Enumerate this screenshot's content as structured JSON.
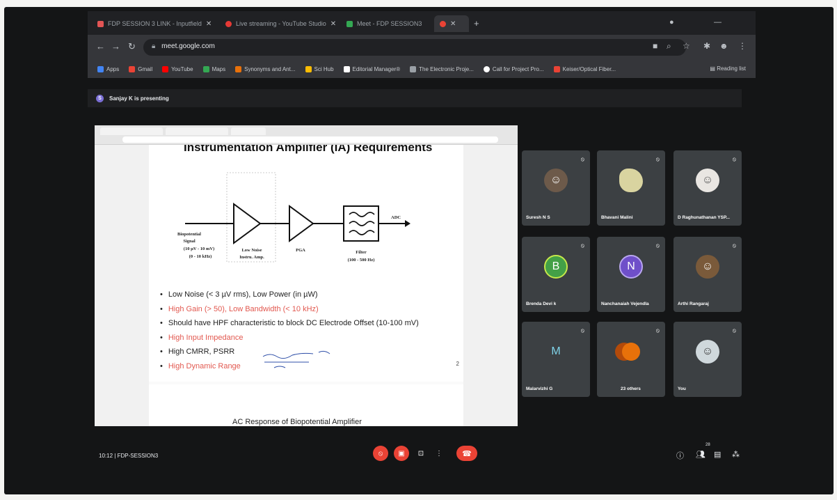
{
  "browser": {
    "tabs": [
      {
        "label": "FDP SESSION 3 LINK - Inputfield",
        "color": "#e25555"
      },
      {
        "label": "Live streaming - YouTube Studio",
        "color": "#e53935"
      },
      {
        "label": "Meet - FDP SESSION3",
        "color": "#34a853"
      },
      {
        "label": "",
        "color": "#ea4335"
      }
    ],
    "url": "meet.google.com",
    "bookmarks": [
      {
        "label": "Apps",
        "color": "#4285f4"
      },
      {
        "label": "Gmail",
        "color": "#ea4335"
      },
      {
        "label": "YouTube",
        "color": "#ff0000"
      },
      {
        "label": "Maps",
        "color": "#34a853"
      },
      {
        "label": "Synonyms and Ant...",
        "color": "#e8710a"
      },
      {
        "label": "Sci Hub",
        "color": "#fbbc04"
      },
      {
        "label": "Editorial Manager®",
        "color": "#ffffff"
      },
      {
        "label": "The Electronic Proje...",
        "color": "#9aa0a6"
      },
      {
        "label": "Call for Project Pro...",
        "color": "#ffffff"
      },
      {
        "label": "Keiser/Optical Fiber...",
        "color": "#ea4335"
      }
    ],
    "reading_list": "Reading list"
  },
  "meet": {
    "presenter_initial": "S",
    "presenter_text": "Sanjay K is presenting",
    "meeting_time": "10:12",
    "meeting_name": "FDP-SESSION3",
    "people_count": "28"
  },
  "slide": {
    "title": "Instrumentation Amplifier (IA) Requirements",
    "diagram": {
      "input_label": [
        "Biopotential",
        "Signal",
        "(10 µV - 10 mV)",
        "(0 - 10 kHz)"
      ],
      "lna_label": [
        "Low Noise",
        "Instru. Amp."
      ],
      "pga_label": "PGA",
      "filter_label": [
        "Filter",
        "(100 - 500 Hz)"
      ],
      "output_label": "ADC"
    },
    "bullets": [
      {
        "text": "Low Noise (< 3 µV rms), Low Power (in µW)",
        "red": false
      },
      {
        "text": "High Gain (> 50), Low Bandwidth (< 10 kHz)",
        "red": true
      },
      {
        "text": "Should have HPF characteristic to block DC Electrode Offset (10-100 mV)",
        "red": false
      },
      {
        "text": "High Input Impedance",
        "red": true
      },
      {
        "text": "High CMRR, PSRR",
        "red": false
      },
      {
        "text": "High Dynamic Range",
        "red": true
      }
    ],
    "page_number": "2",
    "next_title": "AC Response of Biopotential Amplifier"
  },
  "participants": [
    {
      "name": "Suresh N S",
      "type": "photo",
      "color": "#6d5a4a",
      "initial": ""
    },
    {
      "name": "Bhavani Malini",
      "type": "photo",
      "color": "#d9d4a0",
      "initial": ""
    },
    {
      "name": "D Raghunathanan YSP...",
      "type": "photo",
      "color": "#e9e6e2",
      "initial": ""
    },
    {
      "name": "Brenda Devi k",
      "type": "letter",
      "color": "#43a047",
      "initial": "B"
    },
    {
      "name": "Nanchanaiah Vejendla",
      "type": "letter",
      "color": "#6f4fc9",
      "initial": "N"
    },
    {
      "name": "Arthi Rangaraj",
      "type": "photo",
      "color": "#7a5a3a",
      "initial": ""
    },
    {
      "name": "Malarvizhi G",
      "type": "letter",
      "color": "#2e3134",
      "initial": "M"
    },
    {
      "name": "23 others",
      "type": "others",
      "color": "#e8710a",
      "initial": ""
    },
    {
      "name": "You",
      "type": "photo",
      "color": "#cfd8dc",
      "initial": ""
    }
  ]
}
